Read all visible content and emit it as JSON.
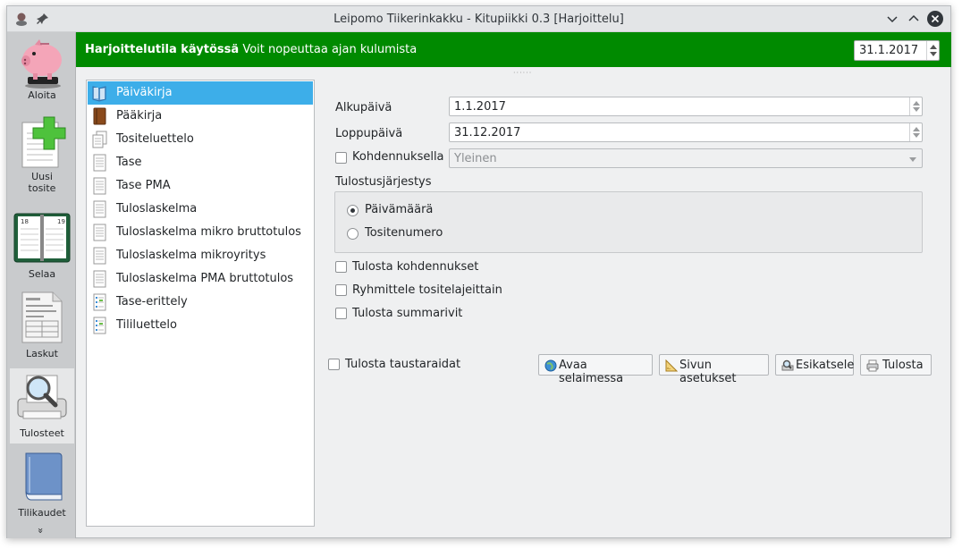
{
  "window": {
    "title": "Leipomo Tiikerinkakku - Kitupiikki 0.3 [Harjoittelu]"
  },
  "sidebar": {
    "items": [
      {
        "label": "Aloita",
        "icon": "piggy-bank-icon"
      },
      {
        "label": "Uusi\ntosite",
        "line1": "Uusi",
        "line2": "tosite",
        "icon": "new-document-icon"
      },
      {
        "label": "Selaa",
        "icon": "calendar-book-icon"
      },
      {
        "label": "Laskut",
        "icon": "invoice-icon"
      },
      {
        "label": "Tulosteet",
        "icon": "print-preview-icon",
        "active": true
      },
      {
        "label": "Tilikaudet",
        "icon": "book-icon"
      }
    ],
    "more": "»"
  },
  "banner": {
    "bold": "Harjoittelutila käytössä",
    "text": "Voit nopeuttaa ajan kulumista",
    "date": "31.1.2017",
    "color": "#008a00"
  },
  "reports": [
    {
      "label": "Päiväkirja",
      "icon": "open-book-icon",
      "selected": true
    },
    {
      "label": "Pääkirja",
      "icon": "brown-book-icon"
    },
    {
      "label": "Tositeluettelo",
      "icon": "documents-icon"
    },
    {
      "label": "Tase",
      "icon": "document-icon"
    },
    {
      "label": "Tase PMA",
      "icon": "document-icon"
    },
    {
      "label": "Tuloslaskelma",
      "icon": "document-icon"
    },
    {
      "label": "Tuloslaskelma mikro bruttotulos",
      "icon": "document-icon"
    },
    {
      "label": "Tuloslaskelma mikroyritys",
      "icon": "document-icon"
    },
    {
      "label": "Tuloslaskelma PMA bruttotulos",
      "icon": "document-icon"
    },
    {
      "label": "Tase-erittely",
      "icon": "list-document-icon"
    },
    {
      "label": "Tililuettelo",
      "icon": "list-document-icon"
    }
  ],
  "form": {
    "start_label": "Alkupäivä",
    "start_value": "1.1.2017",
    "end_label": "Loppupäivä",
    "end_value": "31.12.2017",
    "allocation_label": "Kohdennuksella",
    "allocation_value": "Yleinen",
    "order_label": "Tulostusjärjestys",
    "order_options": [
      {
        "label": "Päivämäärä",
        "checked": true
      },
      {
        "label": "Tositenumero",
        "checked": false
      }
    ],
    "print_allocations": "Tulosta kohdennukset",
    "group_by_type": "Ryhmittele tositelajeittain",
    "print_summary": "Tulosta summarivit",
    "print_stripes": "Tulosta taustaraidat"
  },
  "buttons": {
    "open_browser": "Avaa selaimessa",
    "page_setup": "Sivun asetukset",
    "preview": "Esikatsele",
    "print": "Tulosta"
  },
  "accent_color": "#3daee9"
}
